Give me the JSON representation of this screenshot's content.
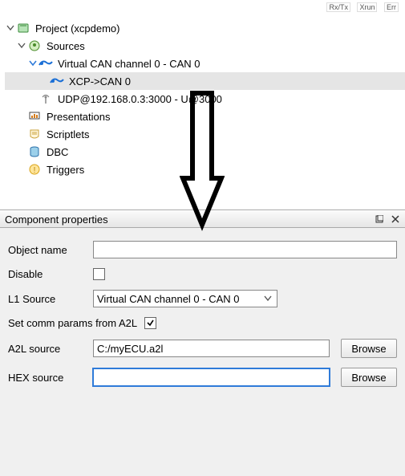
{
  "status_bar": {
    "rxtx": "Rx/Tx",
    "xrun": "Xrun",
    "err": "Err"
  },
  "tree": {
    "project": "Project (xcpdemo)",
    "sources": "Sources",
    "virtual_can": "Virtual CAN channel 0 - CAN 0",
    "xcp_can": "XCP->CAN 0",
    "udp": "UDP@192.168.0.3:3000 - U@3000",
    "presentations": "Presentations",
    "scriptlets": "Scriptlets",
    "dbc": "DBC",
    "triggers": "Triggers"
  },
  "panel": {
    "title": "Component properties",
    "object_name_label": "Object name",
    "object_name_value": "",
    "disable_label": "Disable",
    "disable_checked": false,
    "l1_source_label": "L1 Source",
    "l1_source_value": "Virtual CAN channel 0 - CAN 0",
    "set_comm_label": "Set comm params from A2L",
    "set_comm_checked": true,
    "a2l_label": "A2L source",
    "a2l_value": "C:/myECU.a2l",
    "hex_label": "HEX source",
    "hex_value": "",
    "browse_label": "Browse"
  }
}
